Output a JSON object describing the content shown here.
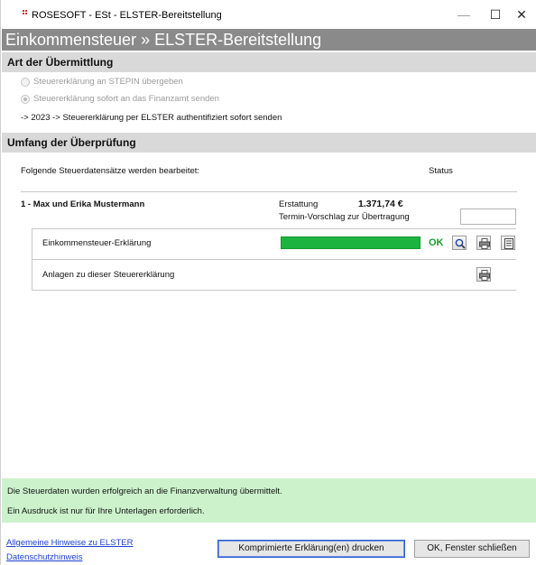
{
  "window": {
    "title": "ROSESOFT - ESt - ELSTER-Bereitstellung",
    "controls": {
      "minimize": "—",
      "maximize": "☐",
      "close": "✕"
    }
  },
  "banner": {
    "title": "Einkommensteuer » ELSTER-Bereitstellung"
  },
  "transmission": {
    "header": "Art der Übermittlung",
    "options": [
      {
        "label": "Steuererklärung an STEPIN übergeben",
        "checked": false
      },
      {
        "label": "Steuererklärung sofort an das Finanzamt senden",
        "checked": true
      }
    ],
    "info": "-> 2023 -> Steuererklärung per ELSTER authentifiziert sofort senden"
  },
  "review": {
    "header": "Umfang der Überprüfung",
    "intro": "Folgende Steuerdatensätze werden bearbeitet:",
    "status_col": "Status",
    "record": {
      "name": "1 - Max und Erika Mustermann",
      "refund_label": "Erstattung",
      "refund_value": "1.371,74 €",
      "schedule_label": "Termin-Vorschlag zur Übertragung",
      "schedule_value": ""
    },
    "rows": [
      {
        "label": "Einkommensteuer-Erklärung",
        "status": "OK",
        "progress": 1.0
      },
      {
        "label": "Anlagen zu dieser Steuererklärung"
      }
    ]
  },
  "status_message": {
    "line1": "Die Steuerdaten wurden erfolgreich an die Finanzverwaltung übermittelt.",
    "line2": "Ein Ausdruck ist nur für Ihre Unterlagen erforderlich.",
    "color": "#ccf2cc"
  },
  "footer": {
    "links": [
      "Allgemeine Hinweise zu ELSTER",
      "Datenschutzhinweis"
    ],
    "print_button": "Komprimierte Erklärung(en) drucken",
    "close_button": "OK, Fenster schließen"
  },
  "colors": {
    "banner": "#8a8a8a",
    "section": "#d9d9d9",
    "progress": "#1db33f",
    "ok": "#1a9a2e",
    "link": "#1a3fcf"
  }
}
